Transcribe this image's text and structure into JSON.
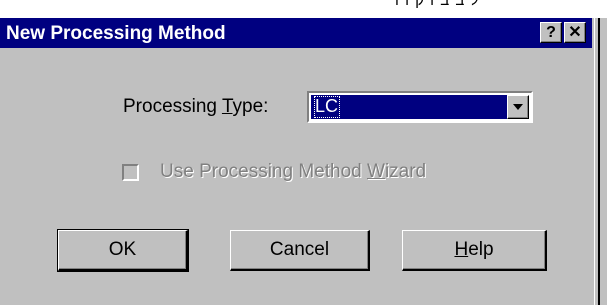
{
  "top_fragment": "ל ב ב ו ק ו ו",
  "dialog": {
    "title": "New Processing Method",
    "help_glyph": "?",
    "close_glyph": "✕",
    "processing_type": {
      "label_before": "Processing ",
      "label_mnemonic": "T",
      "label_after": "ype:",
      "value": "LC"
    },
    "wizard": {
      "label_before": "Use Processing Method ",
      "label_mnemonic": "W",
      "label_after": "izard",
      "checked": false,
      "disabled": true
    },
    "buttons": {
      "ok": "OK",
      "cancel": "Cancel",
      "help_mnemonic": "H",
      "help_rest": "elp"
    }
  }
}
